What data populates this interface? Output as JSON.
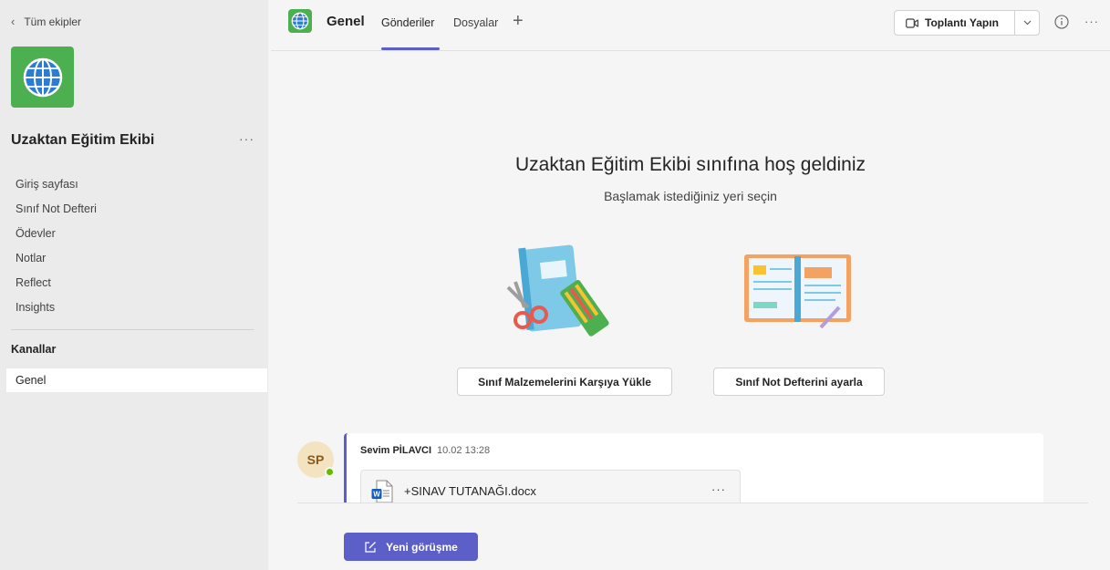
{
  "sidebar": {
    "back_label": "Tüm ekipler",
    "team_name": "Uzaktan Eğitim Ekibi",
    "team_more": "···",
    "items": [
      {
        "label": "Giriş sayfası"
      },
      {
        "label": "Sınıf Not Defteri"
      },
      {
        "label": "Ödevler"
      },
      {
        "label": "Notlar"
      },
      {
        "label": "Reflect"
      },
      {
        "label": "Insights"
      }
    ],
    "channels_label": "Kanallar",
    "channels": [
      {
        "label": "Genel"
      }
    ]
  },
  "header": {
    "channel_title": "Genel",
    "tabs": [
      {
        "label": "Gönderiler"
      },
      {
        "label": "Dosyalar"
      }
    ],
    "add_tab": "+",
    "meet_label": "Toplantı Yapın",
    "more": "···"
  },
  "welcome": {
    "title": "Uzaktan Eğitim Ekibi sınıfına hoş geldiniz",
    "subtitle": "Başlamak istediğiniz yeri seçin",
    "upload_button": "Sınıf Malzemelerini Karşıya Yükle",
    "notebook_button": "Sınıf Not Defterini ayarla"
  },
  "post": {
    "avatar_initials": "SP",
    "author": "Sevim PİLAVCI",
    "time": "10.02 13:28",
    "attachment_name": "+SINAV TUTANAĞI.docx",
    "attachment_more": "···"
  },
  "composer": {
    "new_conversation": "Yeni görüşme"
  },
  "colors": {
    "accent": "#5b5fc7",
    "team_icon_bg": "#4caf50",
    "presence": "#6bb700"
  },
  "icons": [
    "chevron-left-icon",
    "globe-icon",
    "plus-icon",
    "video-icon",
    "chevron-down-icon",
    "info-icon",
    "more-icon",
    "word-doc-icon",
    "compose-icon"
  ]
}
